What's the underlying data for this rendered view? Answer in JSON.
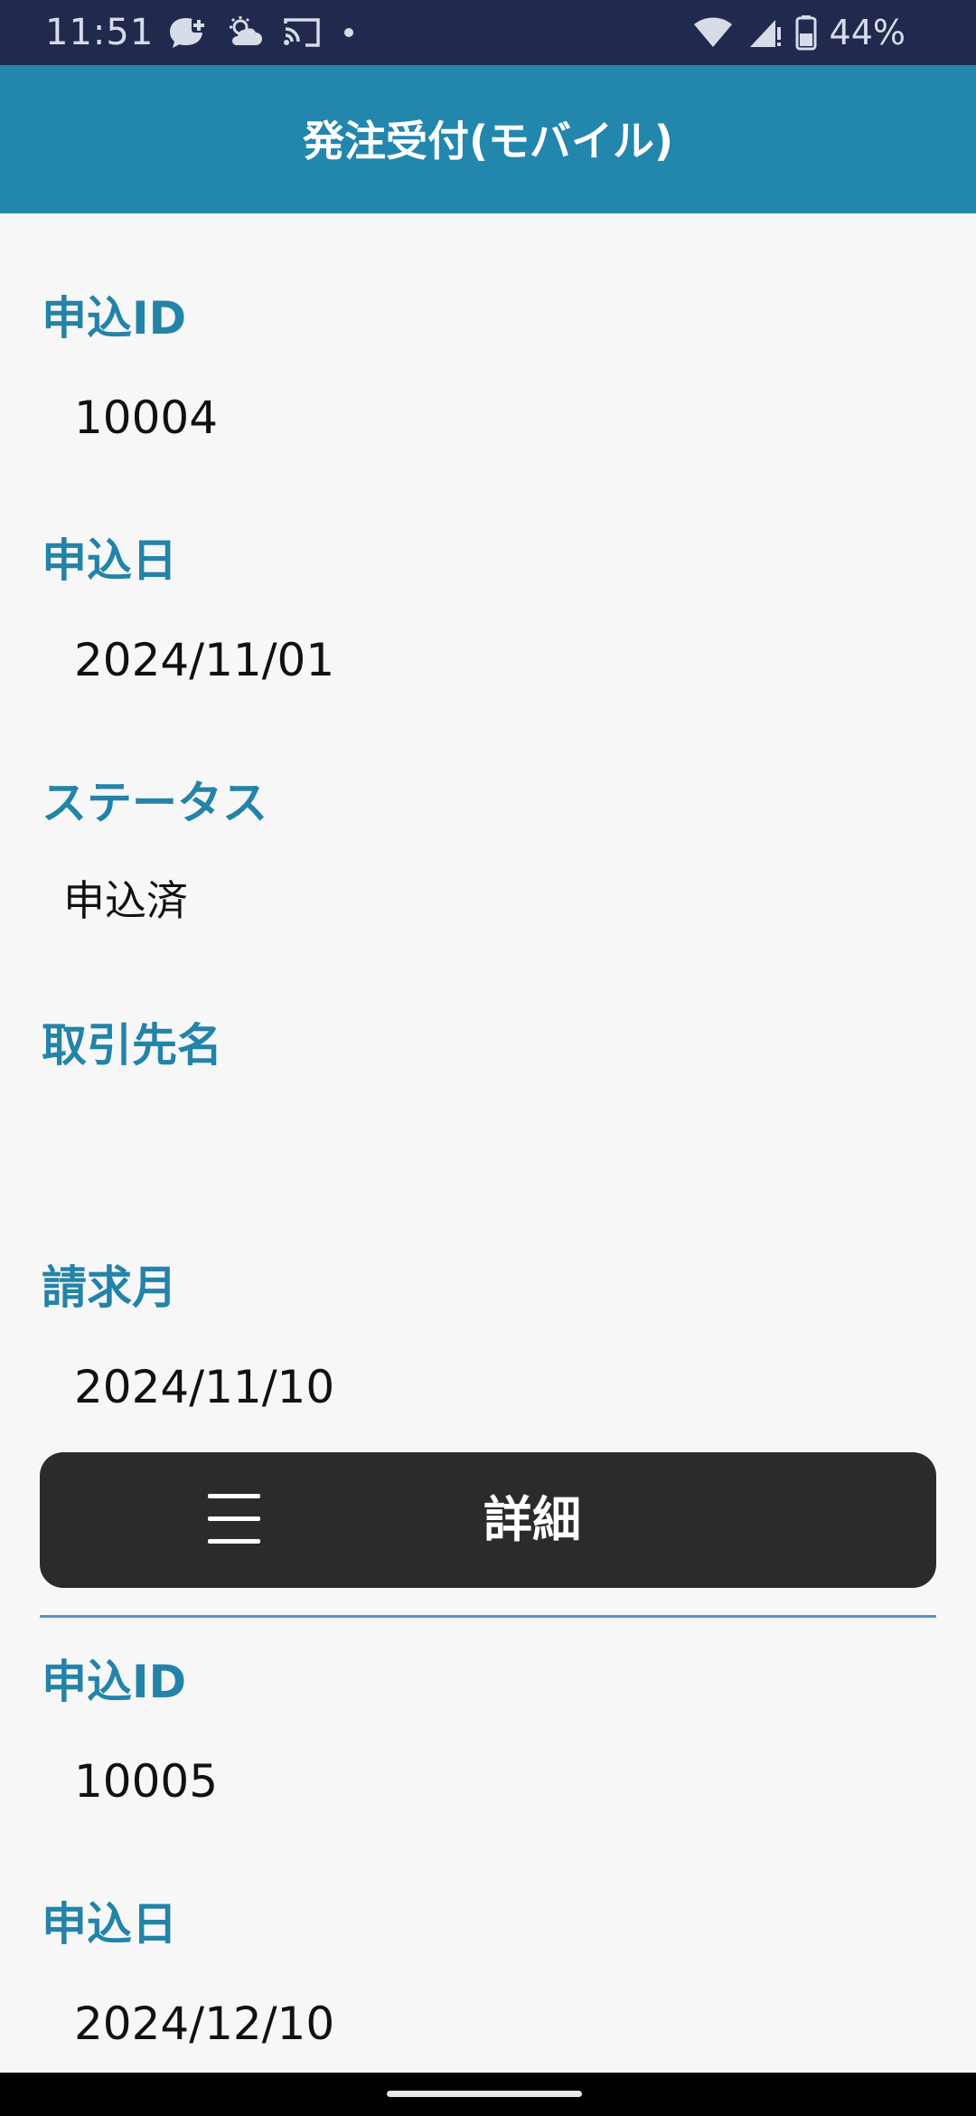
{
  "status_bar": {
    "time": "11:51",
    "left_icons": [
      "messenger-icon",
      "weather-icon",
      "cast-icon",
      "dot-icon"
    ],
    "right_icons": [
      "wifi-icon",
      "signal-icon",
      "battery-icon"
    ],
    "battery": "44%"
  },
  "header": {
    "title": "発注受付(モバイル)"
  },
  "record1": {
    "id_label": "申込ID",
    "id_value": "10004",
    "date_label": "申込日",
    "date_value": "2024/11/01",
    "status_label": "ステータス",
    "status_value": "申込済",
    "client_label": "取引先名",
    "client_value": "",
    "billing_label": "請求月",
    "billing_value": "2024/11/10"
  },
  "action_bar": {
    "menu_icon": "hamburger-menu-icon",
    "detail_label": "詳細"
  },
  "record2": {
    "id_label": "申込ID",
    "id_value": "10005",
    "date_label": "申込日",
    "date_value": "2024/12/10"
  },
  "colors": {
    "status_bar_bg": "#22294e",
    "header_bg": "#2386ad",
    "label_color": "#2383a8",
    "action_bar_bg": "#2b2b2b",
    "divider": "#5d8fcb",
    "page_bg": "#f7f7f7"
  }
}
